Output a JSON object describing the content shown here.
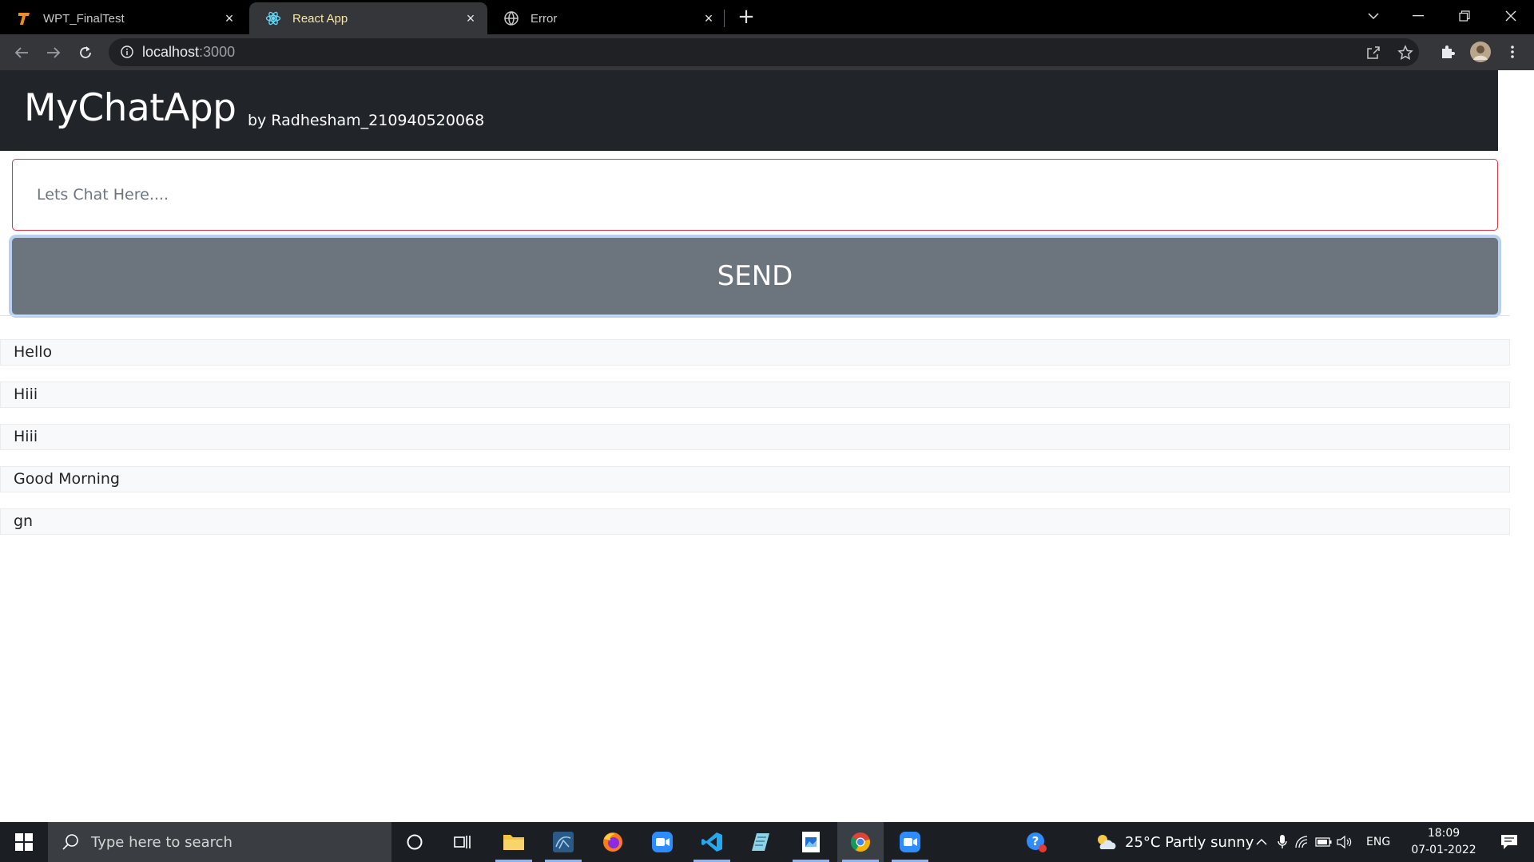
{
  "browser": {
    "tabs": [
      {
        "title": "WPT_FinalTest",
        "icon": "T-logo-icon",
        "active": false
      },
      {
        "title": "React App",
        "icon": "react-icon",
        "active": true
      },
      {
        "title": "Error",
        "icon": "globe-icon",
        "active": false
      }
    ],
    "address": {
      "host": "localhost",
      "port": ":3000"
    }
  },
  "app": {
    "title": "MyChatApp",
    "subtitle": "by Radhesham_210940520068",
    "input_placeholder": "Lets Chat Here....",
    "send_label": "SEND",
    "messages": [
      "Hello",
      "Hiii",
      "Hiii",
      "Good Morning",
      "gn"
    ]
  },
  "taskbar": {
    "search_placeholder": "Type here to search",
    "weather": "25°C  Partly sunny",
    "language": "ENG",
    "time": "18:09",
    "date": "07-01-2022"
  },
  "colors": {
    "header_bg": "#212529",
    "input_border": "#dc3545",
    "send_bg": "#6c757d",
    "active_tab_text": "#f7e7a8"
  }
}
